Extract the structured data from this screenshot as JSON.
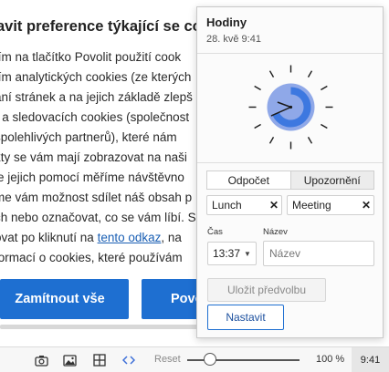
{
  "background_page": {
    "title": "avit preference týkající se coo",
    "lines": [
      "tím na tlačítko Povolit použití cook",
      "tím analytických cookies (ze kterých",
      "ání stránek a na jejich základě zlepš",
      ") a sledovacích cookies (společnost",
      "spolehlivých partnerů), které nám",
      "kty se vám mají zobrazovat na naši",
      "le jejich pomocí měříme návštěvno",
      "me vám možnost sdílet náš obsah p",
      "ch nebo označovat, co se vám líbí. S"
    ],
    "line_link": {
      "prefix": "ovat po kliknutí na ",
      "link": "tento odkaz",
      "suffix": ", na"
    },
    "last_line": "formací o cookies, které používám",
    "reject_button": "Zamítnout vše",
    "accept_button": "Povo"
  },
  "statusbar": {
    "icons": [
      "camera-icon",
      "image-icon",
      "grid-icon",
      "code-icon"
    ],
    "reset_label": "Reset",
    "zoom": "100 %",
    "clock": "9:41",
    "zoom_slider_fraction": 0.12
  },
  "popup": {
    "title": "Hodiny",
    "datetime": "28. kvě 9:41",
    "clock_time": "9:41",
    "tabs": [
      {
        "label": "Odpočet",
        "active": true
      },
      {
        "label": "Upozornění",
        "active": false
      }
    ],
    "presets": [
      "Lunch",
      "Meeting"
    ],
    "time_label": "Čas",
    "time_value": "13:37",
    "name_label": "Název",
    "name_placeholder": "Název",
    "save_button": "Uložit předvolbu",
    "set_button": "Nastavit"
  },
  "colors": {
    "accent": "#1e6fd1",
    "clock_face": "#8fa8e8",
    "clock_arc": "#3d78e0"
  }
}
